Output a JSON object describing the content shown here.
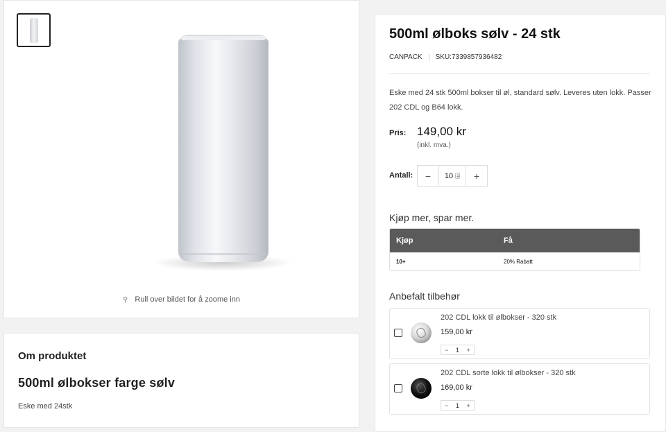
{
  "gallery": {
    "thumbnail_icon": "can-thumbnail",
    "zoom_hint": "Rull over bildet for å zoome inn",
    "zoom_icon": "magnifier-icon"
  },
  "about": {
    "title": "Om produktet",
    "subtitle": "500ml ølbokser farge sølv",
    "description": "Eske med 24stk"
  },
  "product": {
    "title": "500ml ølboks sølv - 24 stk",
    "brand": "CANPACK",
    "sku": "SKU:7339857936482",
    "description": "Eske med 24 stk 500ml bokser til øl, standard sølv. Leveres uten lokk. Passer 202 CDL og B64 lokk.",
    "price_label": "Pris:",
    "price": "149,00 kr",
    "vat_note": "(inkl. mva.)",
    "quantity_label": "Antall:",
    "quantity": "10",
    "minus": "−",
    "plus": "+"
  },
  "bulk": {
    "title": "Kjøp mer, spar mer.",
    "headers": [
      "Kjøp",
      "Få"
    ],
    "rows": [
      [
        "10+",
        "20% Rabatt"
      ]
    ],
    "header_color": "#5a5a5a"
  },
  "accessories": {
    "title": "Anbefalt tilbehør",
    "items": [
      {
        "name": "202 CDL lokk til ølbokser - 320 stk",
        "price": "159,00 kr",
        "quantity": "1",
        "lid": "silver"
      },
      {
        "name": "202 CDL sorte lokk til ølbokser - 320 stk",
        "price": "169,00 kr",
        "quantity": "1",
        "lid": "black"
      }
    ]
  }
}
